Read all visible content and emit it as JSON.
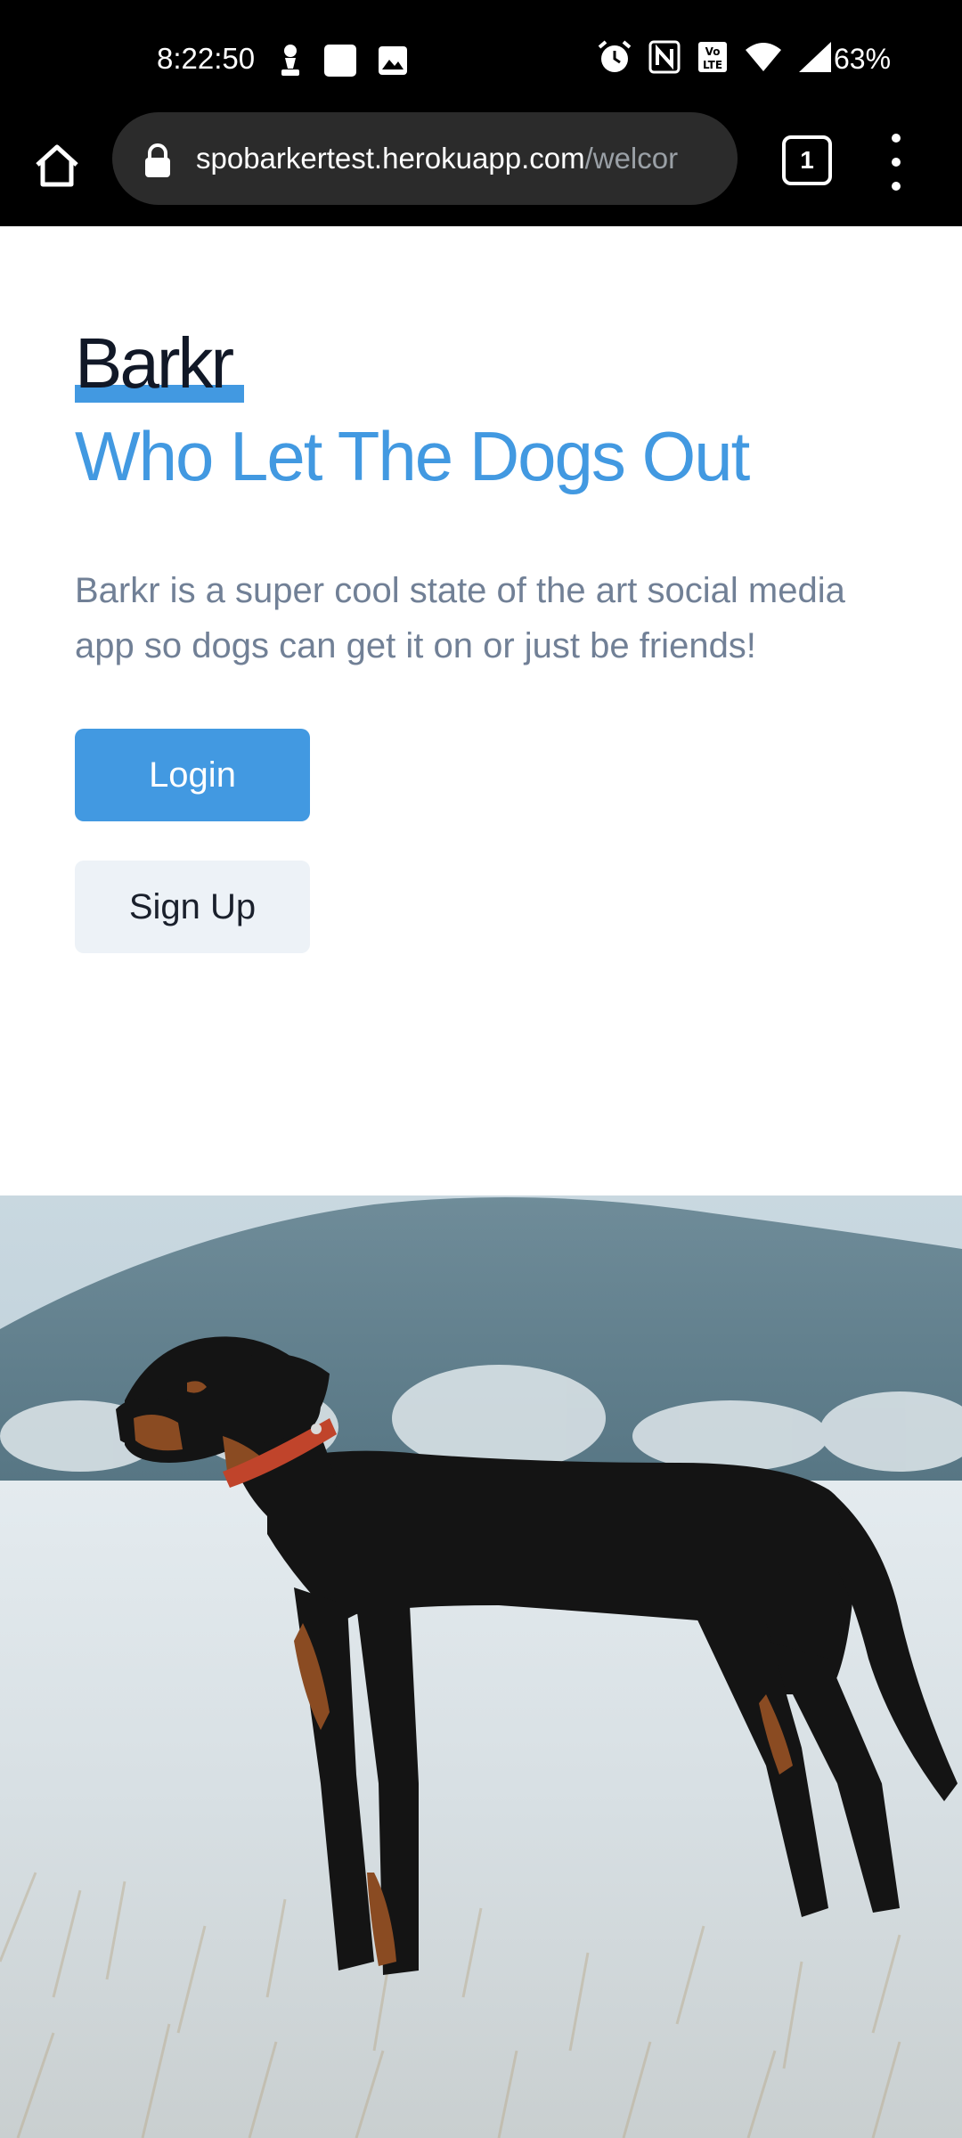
{
  "status_bar": {
    "time": "8:22:50",
    "battery": "63%",
    "icons_left": [
      "chess-pawn-icon",
      "square-notification-icon",
      "image-notification-icon"
    ],
    "icons_right": [
      "alarm-icon",
      "nfc-icon",
      "volte-icon",
      "wifi-icon",
      "signal-icon"
    ]
  },
  "browser": {
    "url_host": "spobarkertest.herokuapp.com",
    "url_path": "/welcor",
    "tab_count": "1"
  },
  "page": {
    "brand": "Barkr",
    "headline": "Who Let The Dogs Out",
    "description": "Barkr is a super cool state of the art social media app so dogs can get it on or just be friends!",
    "login_label": "Login",
    "signup_label": "Sign Up"
  },
  "colors": {
    "accent": "#4299e1",
    "text_dark": "#111827",
    "text_muted": "#718096",
    "secondary_button": "#edf2f7"
  }
}
